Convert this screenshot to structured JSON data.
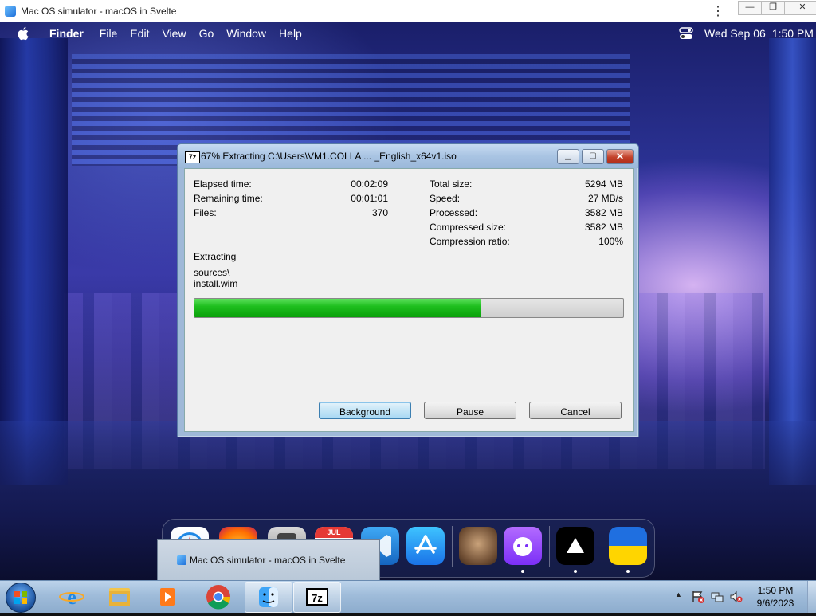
{
  "host_window": {
    "title": "Mac OS simulator - macOS in Svelte",
    "controls": {
      "minimize": "—",
      "restore": "❐",
      "close": "✕"
    },
    "menu_icon": "⋮"
  },
  "mac_menubar": {
    "app_name": "Finder",
    "menus": [
      "File",
      "Edit",
      "View",
      "Go",
      "Window",
      "Help"
    ],
    "date": "Wed Sep 06",
    "time": "1:50 PM"
  },
  "dialog": {
    "title": "67% Extracting C:\\Users\\VM1.COLLA ... _English_x64v1.iso",
    "icon_label": "7z",
    "stats_left": [
      {
        "label": "Elapsed time:",
        "value": "00:02:09"
      },
      {
        "label": "Remaining time:",
        "value": "00:01:01"
      },
      {
        "label": "Files:",
        "value": "370"
      }
    ],
    "stats_right": [
      {
        "label": "Total size:",
        "value": "5294 MB"
      },
      {
        "label": "Speed:",
        "value": "27 MB/s"
      },
      {
        "label": "Processed:",
        "value": "3582 MB"
      },
      {
        "label": "Compressed size:",
        "value": "3582 MB"
      },
      {
        "label": "Compression ratio:",
        "value": "100%"
      }
    ],
    "status": "Extracting",
    "current_path": "sources\\",
    "current_file": "install.wim",
    "progress_percent": 67,
    "buttons": {
      "background": "Background",
      "pause": "Pause",
      "cancel": "Cancel"
    }
  },
  "dock": {
    "calendar_month": "JUL",
    "items": [
      {
        "name": "safari-icon",
        "running": false
      },
      {
        "name": "firefox-icon",
        "running": false
      },
      {
        "name": "calculator-icon",
        "running": false
      },
      {
        "name": "calendar-icon",
        "running": false
      },
      {
        "name": "vscode-icon",
        "running": false
      },
      {
        "name": "app-store-icon",
        "running": false
      },
      {
        "name": "cat-photo-icon",
        "running": false
      },
      {
        "name": "github-icon",
        "running": true
      },
      {
        "name": "vercel-icon",
        "running": true
      },
      {
        "name": "ukraine-flag-icon",
        "running": true
      }
    ]
  },
  "taskbar_preview": {
    "label": "Mac OS simulator - macOS in Svelte"
  },
  "taskbar": {
    "pinned": [
      "internet-explorer-icon",
      "file-explorer-icon",
      "media-player-icon",
      "chrome-icon",
      "finder-app-icon",
      "7zip-icon"
    ],
    "clock_time": "1:50 PM",
    "clock_date": "9/6/2023",
    "tray_arrow": "▲"
  },
  "colors": {
    "progress_fill": "#1fbf1f",
    "close_button": "#c2412a",
    "taskbar": "#9fbcda"
  }
}
